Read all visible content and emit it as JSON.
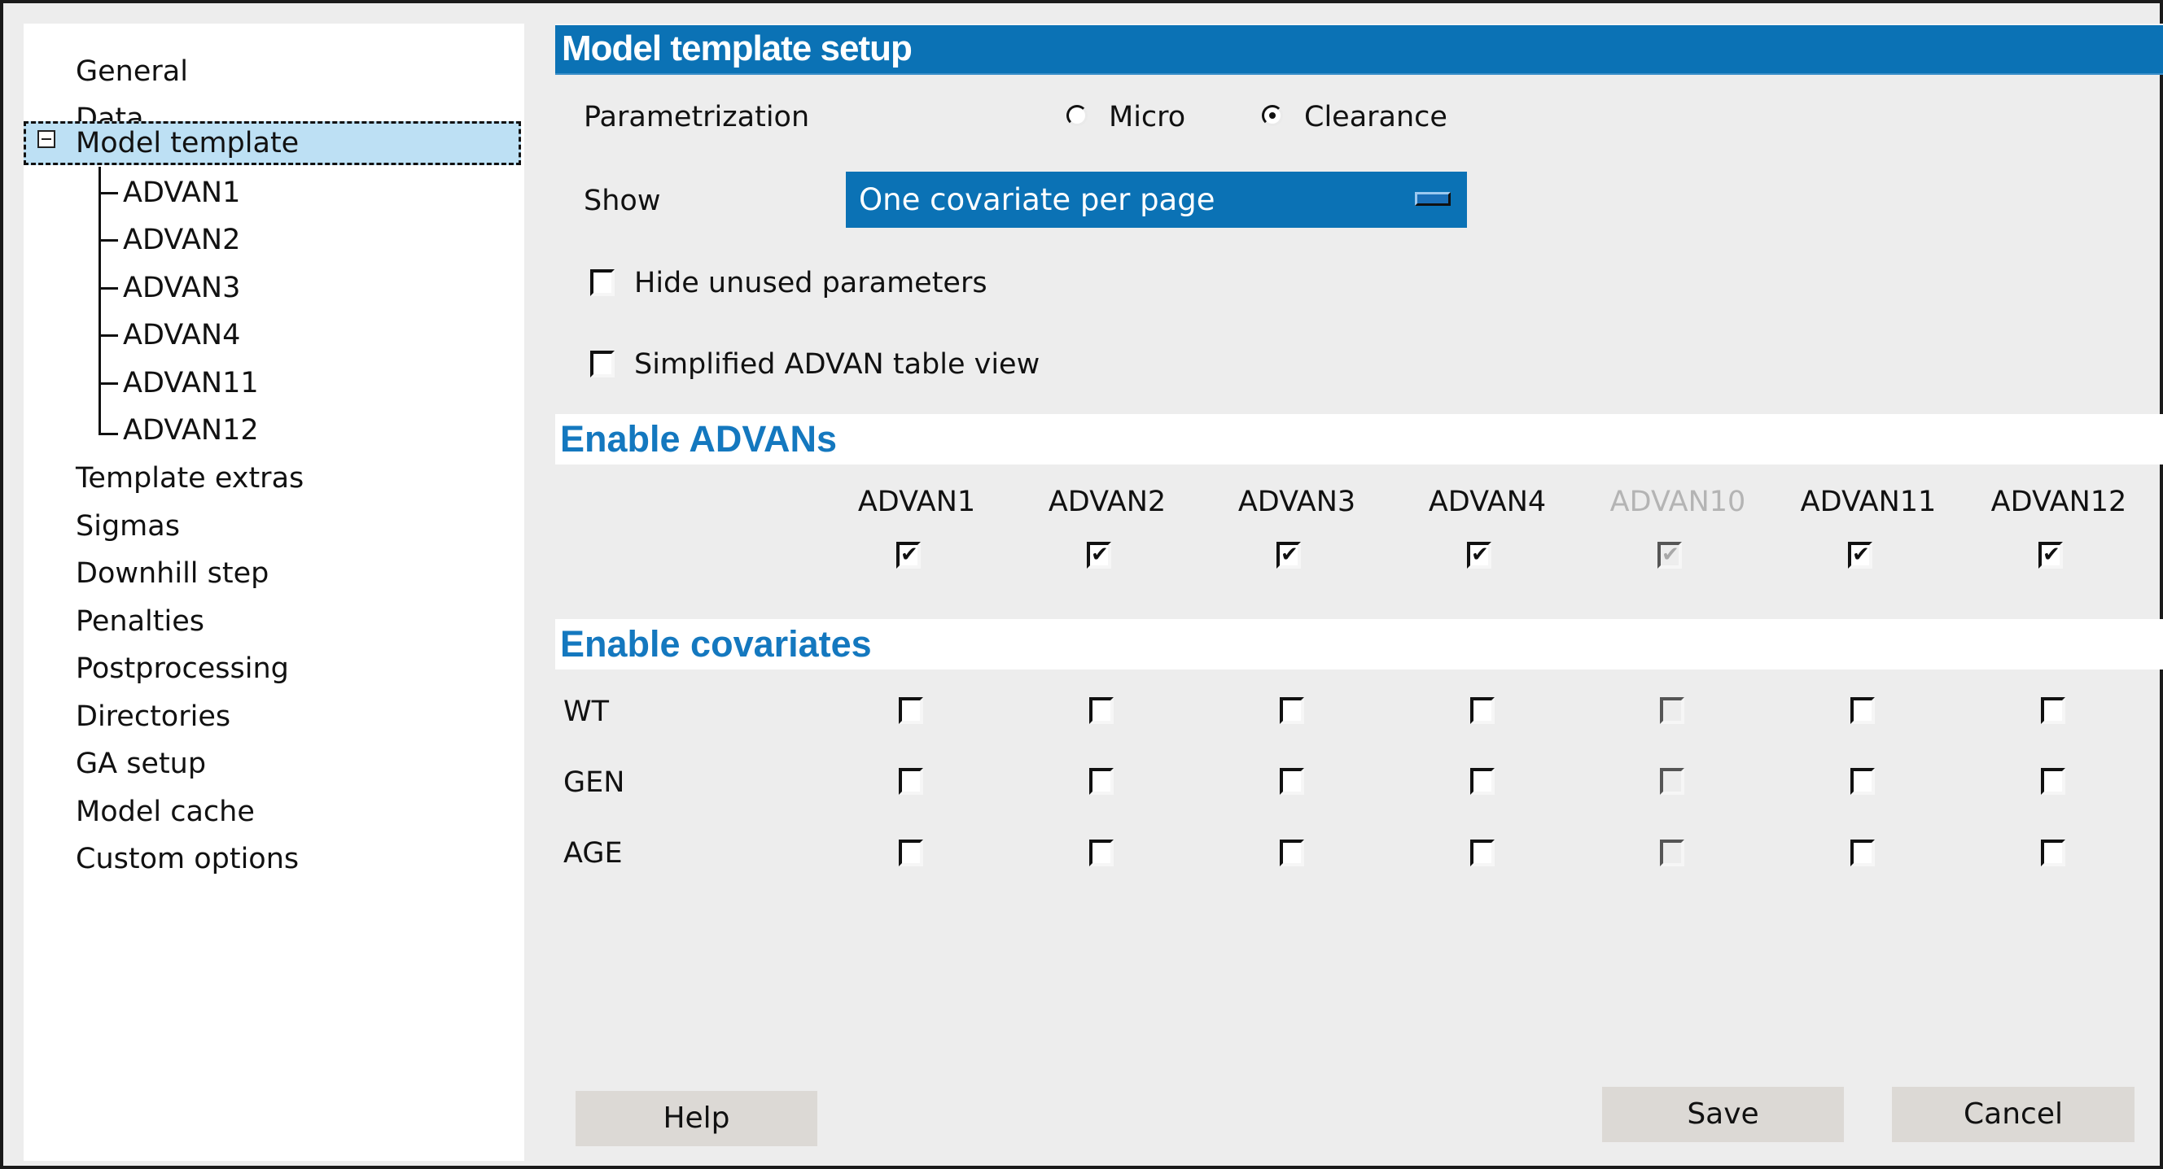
{
  "sidebar": {
    "items": [
      {
        "label": "General"
      },
      {
        "label": "Data"
      },
      {
        "label": "Model template",
        "expanded": true,
        "selected": true,
        "children": [
          {
            "label": "ADVAN1"
          },
          {
            "label": "ADVAN2"
          },
          {
            "label": "ADVAN3"
          },
          {
            "label": "ADVAN4"
          },
          {
            "label": "ADVAN11"
          },
          {
            "label": "ADVAN12"
          }
        ]
      },
      {
        "label": "Template extras"
      },
      {
        "label": "Sigmas"
      },
      {
        "label": "Downhill step"
      },
      {
        "label": "Penalties"
      },
      {
        "label": "Postprocessing"
      },
      {
        "label": "Directories"
      },
      {
        "label": "GA setup"
      },
      {
        "label": "Model cache"
      },
      {
        "label": "Custom options"
      }
    ]
  },
  "header": {
    "title": "Model template setup"
  },
  "parametrization": {
    "label": "Parametrization",
    "options": [
      {
        "label": "Micro",
        "checked": false
      },
      {
        "label": "Clearance",
        "checked": true
      }
    ]
  },
  "show": {
    "label": "Show",
    "selected": "One covariate per page"
  },
  "options": {
    "hide_unused": {
      "label": "Hide unused parameters",
      "checked": false
    },
    "simplified_table": {
      "label": "Simplified ADVAN table view",
      "checked": false
    }
  },
  "enable_advans": {
    "title": "Enable ADVANs",
    "columns": [
      {
        "label": "ADVAN1",
        "checked": true,
        "disabled": false
      },
      {
        "label": "ADVAN2",
        "checked": true,
        "disabled": false
      },
      {
        "label": "ADVAN3",
        "checked": true,
        "disabled": false
      },
      {
        "label": "ADVAN4",
        "checked": true,
        "disabled": false
      },
      {
        "label": "ADVAN10",
        "checked": true,
        "disabled": true
      },
      {
        "label": "ADVAN11",
        "checked": true,
        "disabled": false
      },
      {
        "label": "ADVAN12",
        "checked": true,
        "disabled": false
      }
    ]
  },
  "enable_covariates": {
    "title": "Enable covariates",
    "rows": [
      {
        "label": "WT",
        "values": [
          false,
          false,
          false,
          false,
          false,
          false,
          false
        ]
      },
      {
        "label": "GEN",
        "values": [
          false,
          false,
          false,
          false,
          false,
          false,
          false
        ]
      },
      {
        "label": "AGE",
        "values": [
          false,
          false,
          false,
          false,
          false,
          false,
          false
        ]
      }
    ]
  },
  "buttons": {
    "help": "Help",
    "save": "Save",
    "cancel": "Cancel"
  },
  "colors": {
    "accent": "#0b72b5",
    "section_title": "#1478bf",
    "selection": "#bde0f4",
    "button": "#dcd9d5"
  }
}
